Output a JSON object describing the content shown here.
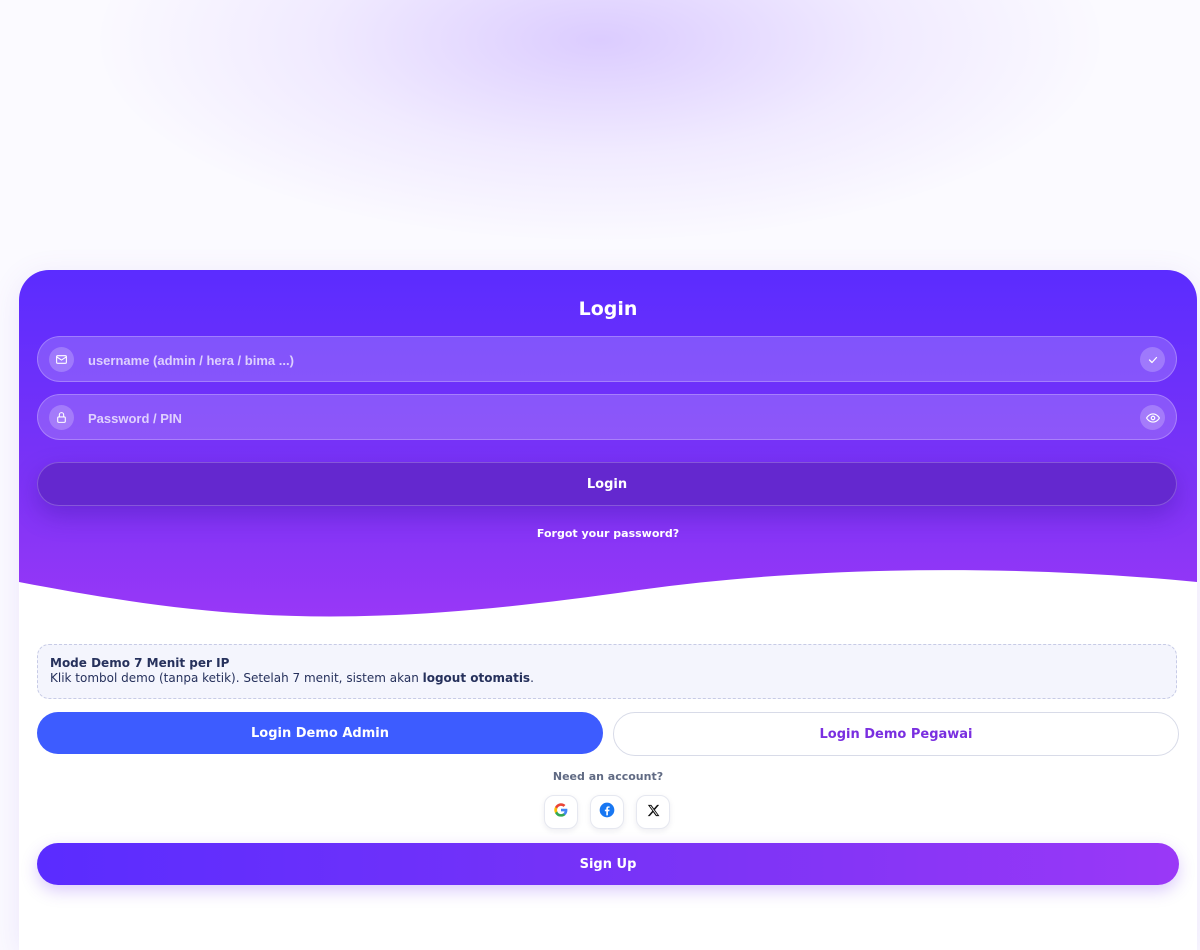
{
  "login": {
    "title": "Login",
    "username_placeholder": "username (admin / hera / bima ...)",
    "username_value": "",
    "password_placeholder": "Password / PIN",
    "password_value": "",
    "submit_label": "Login",
    "forgot_label": "Forgot your password?"
  },
  "demo": {
    "heading": "Mode Demo 7 Menit per IP",
    "text_before": "Klik tombol demo (tanpa ketik). Setelah 7 menit, sistem akan ",
    "text_bold": "logout otomatis",
    "text_after": ".",
    "admin_button": "Login Demo Admin",
    "pegawai_button": "Login Demo Pegawai"
  },
  "signup": {
    "prompt": "Need an account?",
    "button": "Sign Up",
    "social": [
      {
        "icon": "google-icon"
      },
      {
        "icon": "facebook-icon"
      },
      {
        "icon": "x-icon"
      }
    ]
  },
  "colors": {
    "gradient_start": "#5b2cff",
    "gradient_end": "#9b38f7",
    "admin_button": "#3d5cff",
    "pegawai_text": "#7a2fe0"
  }
}
